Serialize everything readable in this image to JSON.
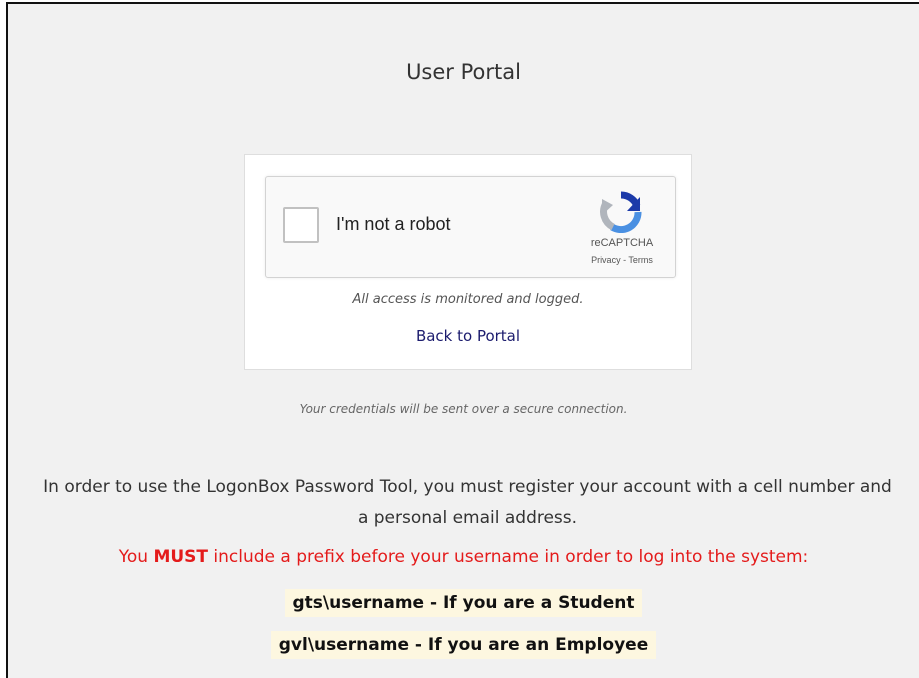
{
  "page": {
    "title": "User Portal"
  },
  "recaptcha": {
    "checkbox_label": "I'm not a robot",
    "brand": "reCAPTCHA",
    "privacy_link": "Privacy",
    "separator": " - ",
    "terms_link": "Terms",
    "checked": false
  },
  "card": {
    "monitored_notice": "All access is monitored and logged.",
    "back_link": "Back to Portal"
  },
  "secure_notice": "Your credentials will be sent over a secure connection.",
  "instructions": {
    "info": "In order to use the LogonBox Password Tool, you must register your account with a cell number and a personal email address.",
    "warning_before": "You ",
    "warning_emphasis": "MUST",
    "warning_after": " include a prefix before your username in order to log into the system:",
    "prefixes": [
      "gts\\username - If you are a Student",
      "gvl\\username - If you are an Employee"
    ]
  },
  "colors": {
    "warning_red": "#e41b1b",
    "link_navy": "#1c1c6e",
    "prefix_highlight": "#fdf7e0",
    "recaptcha_blue": "#1c3aa9",
    "recaptcha_light_blue": "#4a90e2",
    "recaptcha_gray": "#b0b5bc"
  }
}
